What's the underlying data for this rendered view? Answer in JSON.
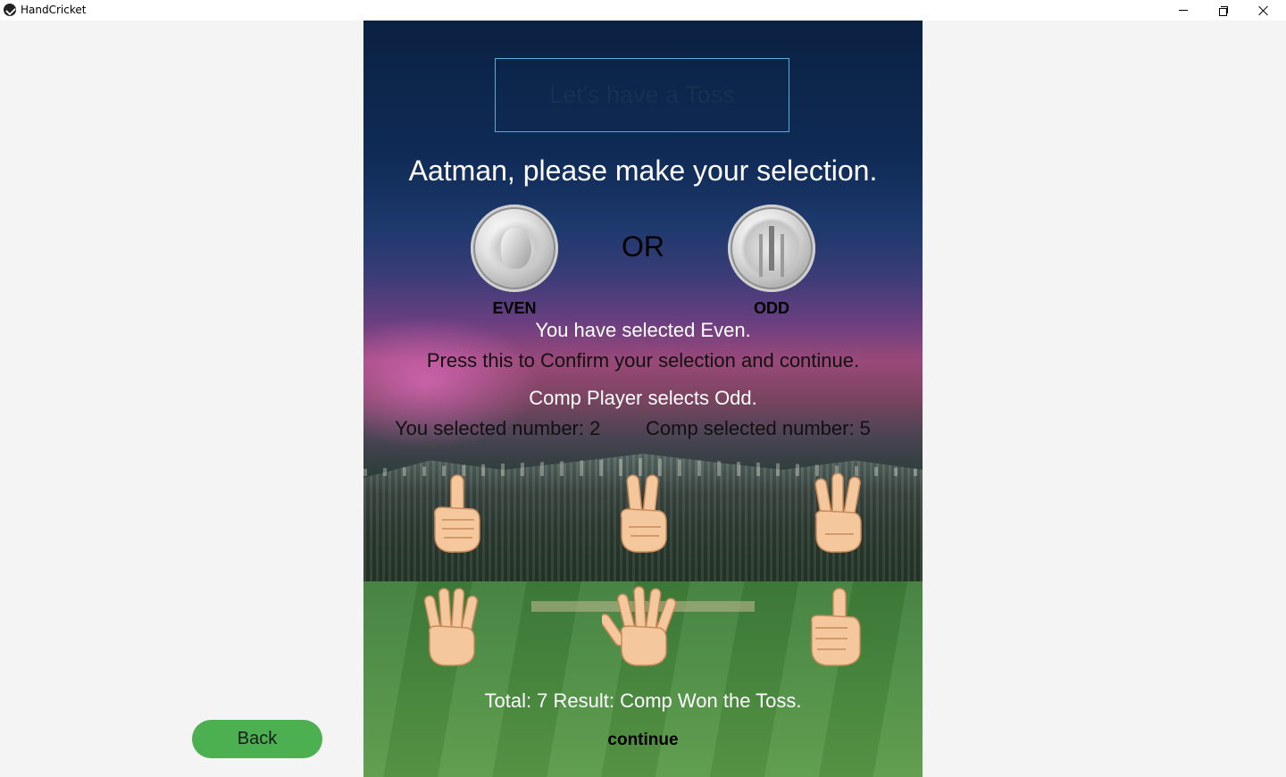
{
  "window": {
    "title": "HandCricket",
    "icon": "app-logo-icon",
    "controls": [
      "minimize-icon",
      "restore-icon",
      "close-icon"
    ]
  },
  "toss": {
    "heading": "Let's have a Toss",
    "prompt": "Aatman, please make your selection.",
    "or_label": "OR",
    "even_label": "EVEN",
    "odd_label": "ODD",
    "selected_text": "You have selected Even.",
    "confirm_text": "Press this to Confirm your selection and continue.",
    "comp_selection": "Comp Player selects Odd.",
    "you_number": "You selected number: 2",
    "comp_number": "Comp selected number: 5",
    "result": "Total: 7 Result:  Comp Won the Toss.",
    "continue_label": "continue"
  },
  "hands": [
    {
      "gesture": "one",
      "icon": "one-finger-hand-icon"
    },
    {
      "gesture": "two",
      "icon": "two-fingers-hand-icon"
    },
    {
      "gesture": "three",
      "icon": "three-fingers-hand-icon"
    },
    {
      "gesture": "four",
      "icon": "four-fingers-hand-icon"
    },
    {
      "gesture": "five",
      "icon": "five-fingers-hand-icon"
    },
    {
      "gesture": "six",
      "icon": "thumbs-up-hand-icon"
    }
  ],
  "nav": {
    "back_label": "Back"
  },
  "colors": {
    "back_button": "#4caf50",
    "toss_box_border": "#4fb0d8",
    "hand_skin": "#f5c79c"
  }
}
